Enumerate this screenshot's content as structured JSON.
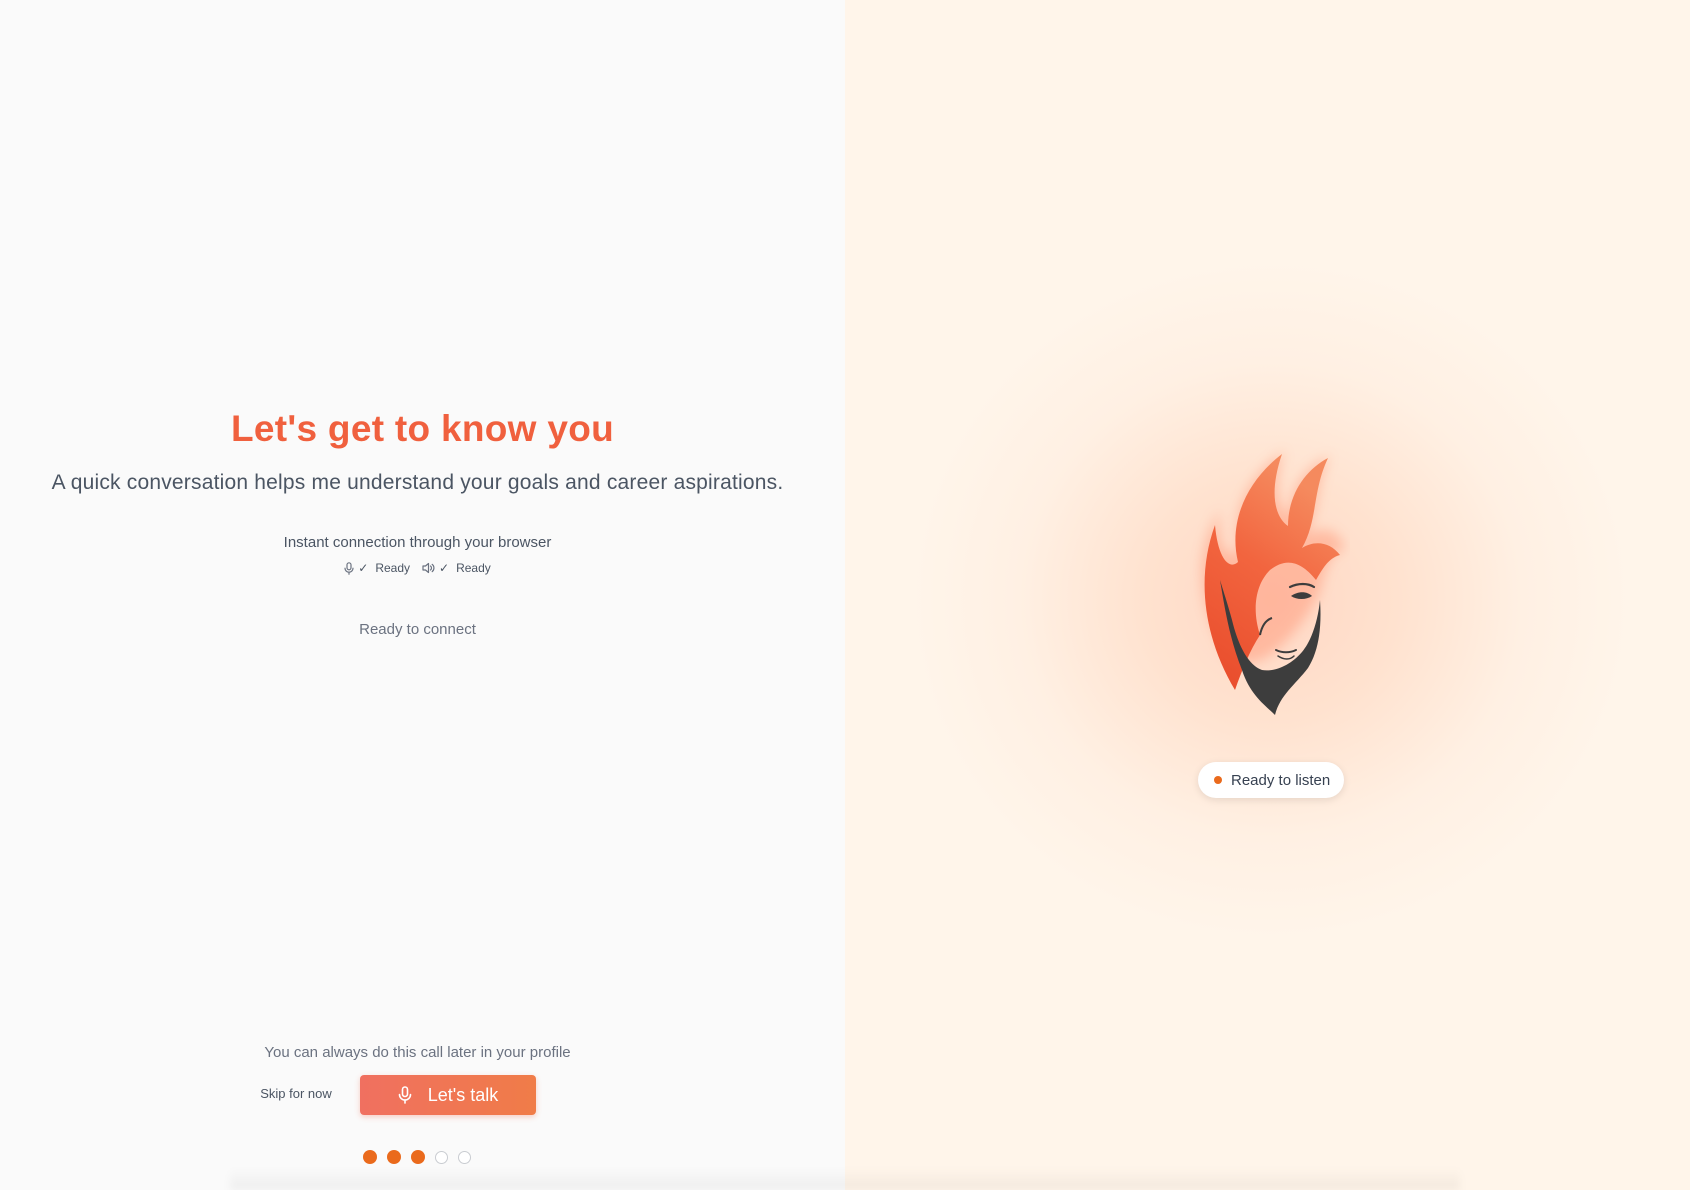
{
  "onboarding": {
    "title": "Let's get to know you",
    "subtitle": "A quick conversation helps me understand your goals and career aspirations.",
    "connection_text": "Instant connection through your browser",
    "mic_status": {
      "icon": "microphone-icon",
      "check": "✓",
      "label": "Ready"
    },
    "speaker_status": {
      "icon": "speaker-icon",
      "check": "✓",
      "label": "Ready"
    },
    "connect_status": "Ready to connect",
    "later_text": "You can always do this call later in your profile",
    "skip_label": "Skip for now",
    "talk_label": "Let's talk",
    "talk_icon": "microphone-icon"
  },
  "progress": {
    "total_steps": 5,
    "completed_steps": 3
  },
  "assistant": {
    "avatar_icon": "flame-face-icon",
    "status_label": "Ready to listen"
  },
  "colors": {
    "accent": "#f0603e",
    "button_gradient_start": "#f07060",
    "button_gradient_end": "#f07c48",
    "progress_dot": "#ea6a1c",
    "status_dot": "#ea6a1c"
  }
}
